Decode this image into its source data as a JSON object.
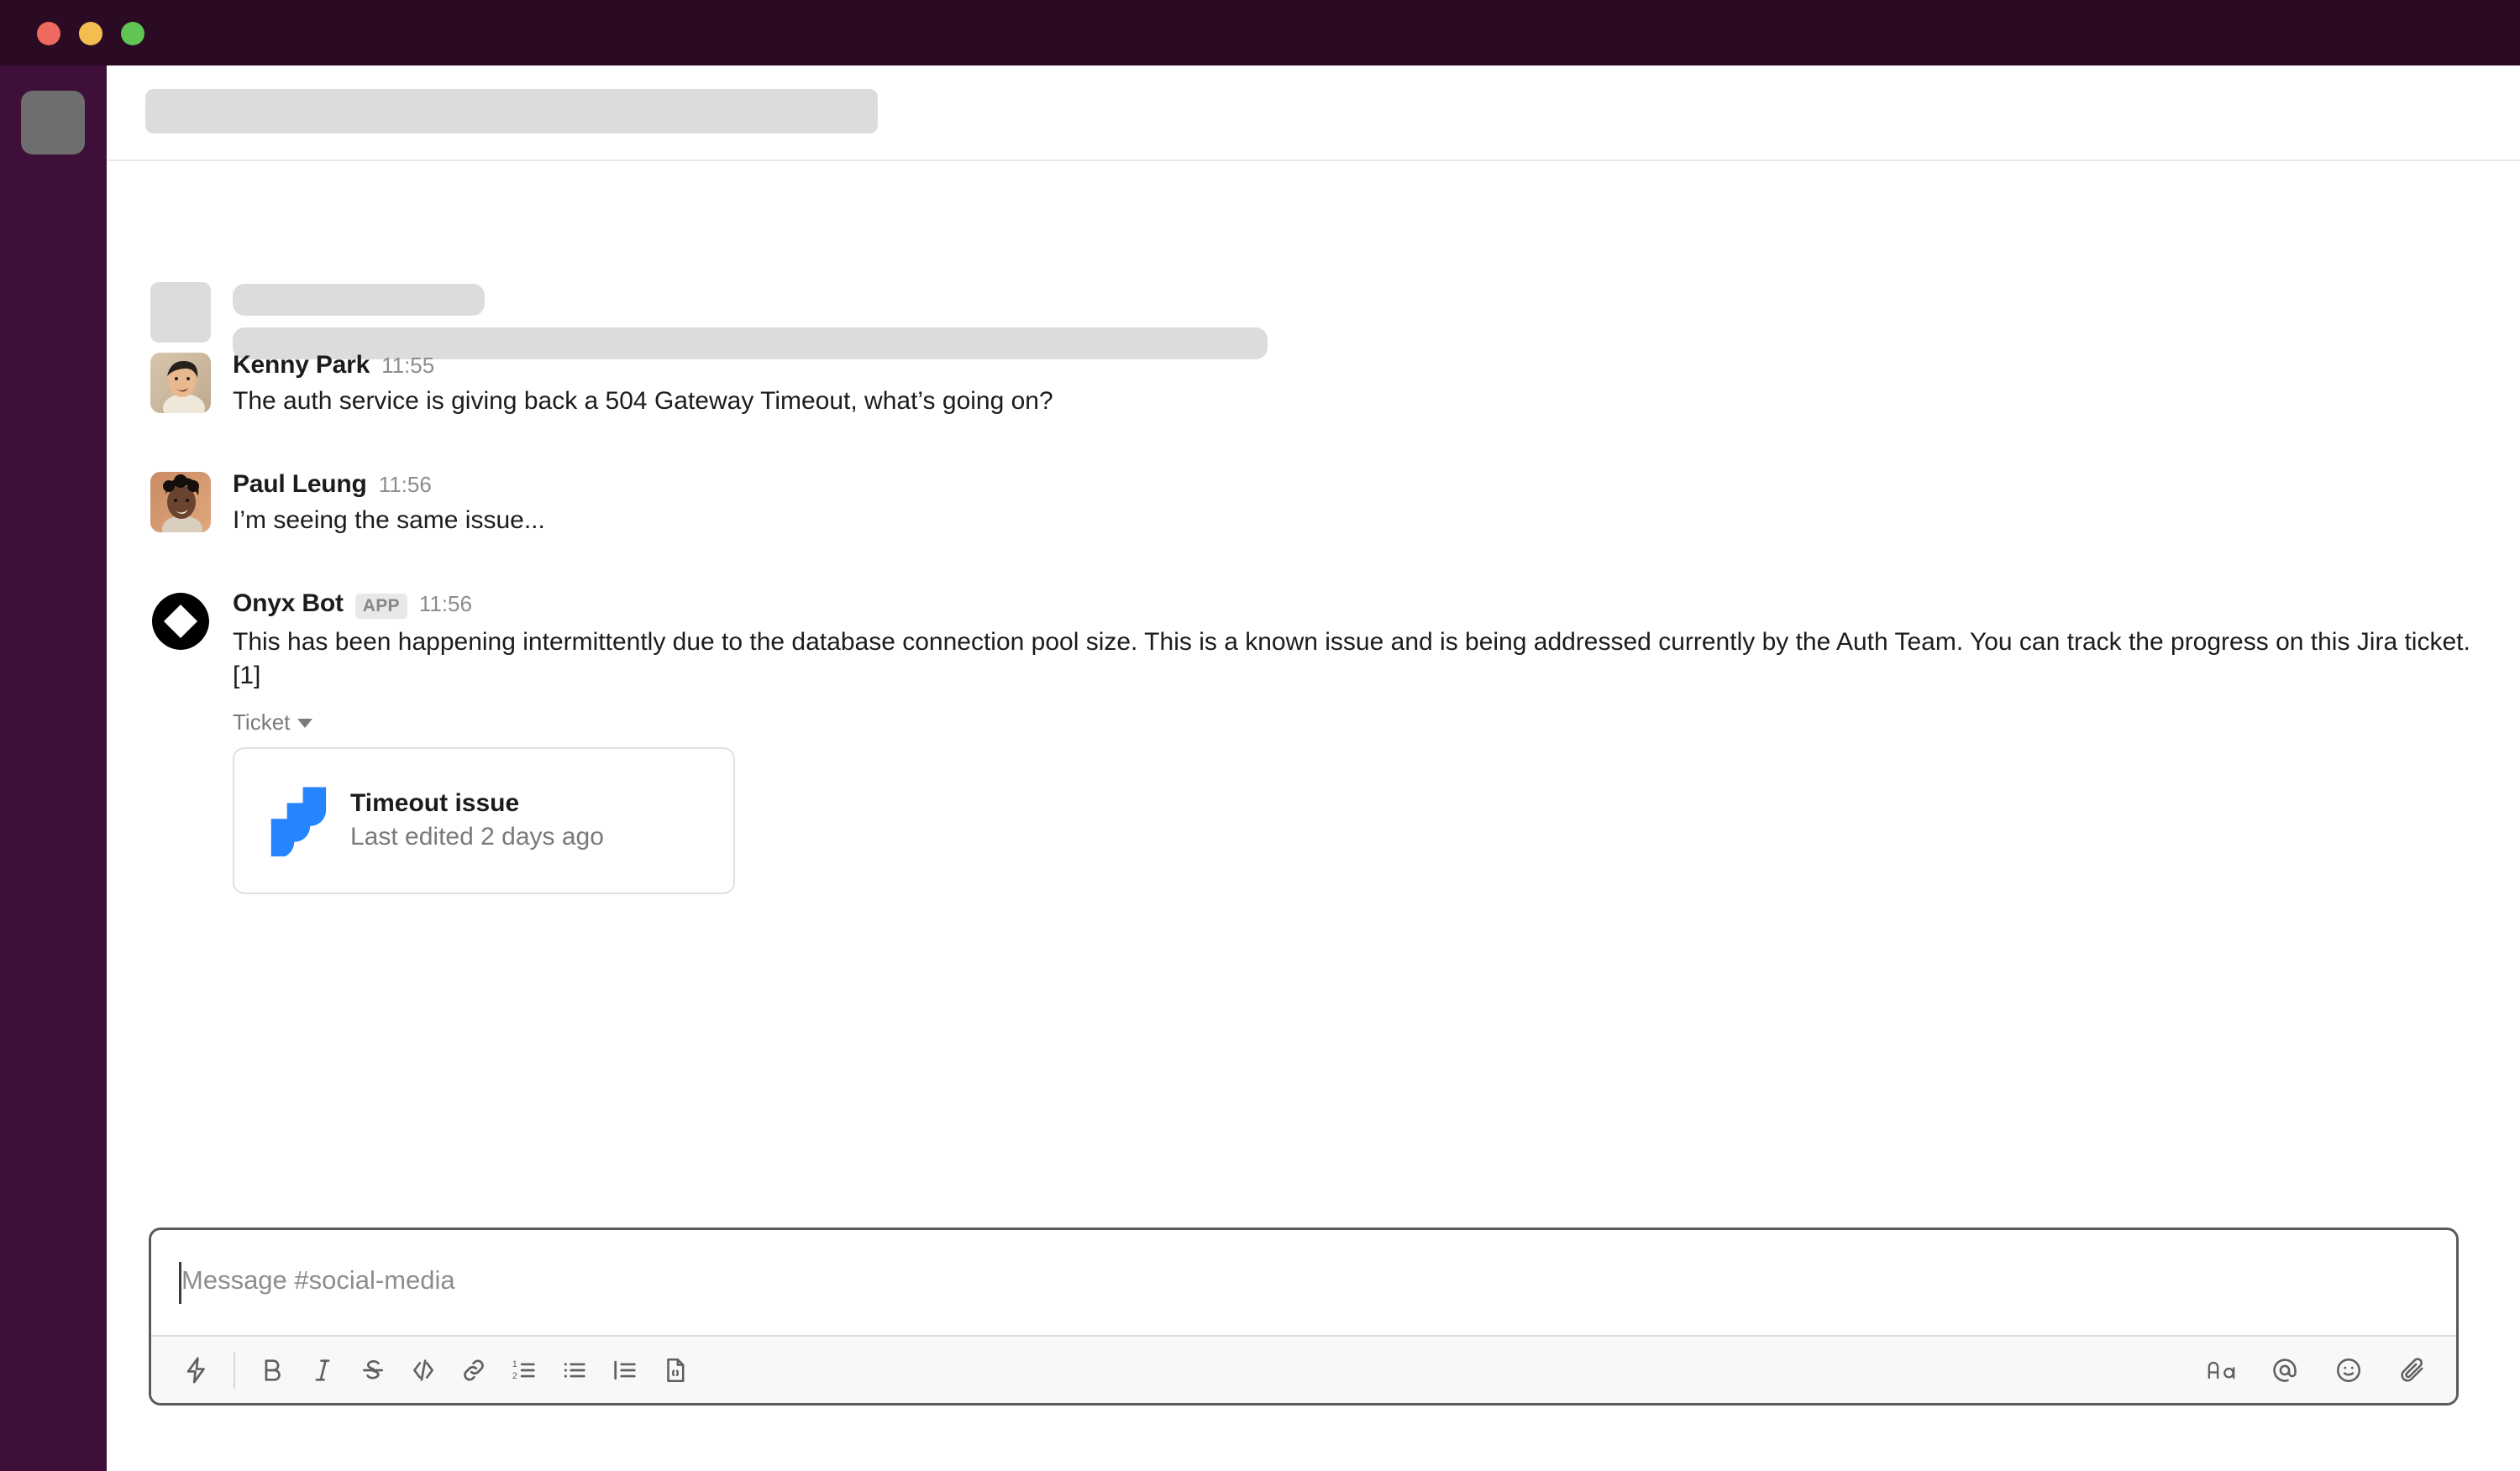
{
  "window": {
    "traffic_lights": [
      "close",
      "minimize",
      "zoom"
    ],
    "titlebar_color": "#2B0B24",
    "sidebar_color": "#3E1039"
  },
  "sidebar": {
    "workspace_tile": "workspace-avatar-placeholder"
  },
  "header": {
    "channel_title_placeholder": "loading-channel-title"
  },
  "messages": [
    {
      "type": "skeleton",
      "author": "",
      "time": "",
      "text": ""
    },
    {
      "type": "user",
      "author": "Kenny Park",
      "time": "11:55",
      "text": "The auth service is giving back a 504 Gateway Timeout, what’s going on?",
      "avatar": "kenny-park-avatar"
    },
    {
      "type": "user",
      "author": "Paul Leung",
      "time": "11:56",
      "text": "I’m seeing the same issue...",
      "avatar": "paul-leung-avatar"
    },
    {
      "type": "bot",
      "author": "Onyx Bot",
      "badge": "APP",
      "time": "11:56",
      "text": "This has been happening intermittently due to the database connection pool size. This is a known issue and is being addressed currently by the Auth Team. You can track the progress on this Jira ticket. [1]",
      "avatar": "onyx-bot-logo",
      "attachment": {
        "toggle_label": "Ticket",
        "title": "Timeout issue",
        "subtitle": "Last edited 2 days ago",
        "source_icon": "jira-icon",
        "accent_color": "#2684FF"
      }
    }
  ],
  "composer": {
    "placeholder": "Message #social-media",
    "value": "",
    "toolbar_left": [
      {
        "name": "shortcuts-lightning-icon",
        "label": "Shortcuts"
      },
      {
        "name": "bold-icon",
        "label": "Bold"
      },
      {
        "name": "italic-icon",
        "label": "Italic"
      },
      {
        "name": "strikethrough-icon",
        "label": "Strikethrough"
      },
      {
        "name": "code-icon",
        "label": "Code"
      },
      {
        "name": "link-icon",
        "label": "Link"
      },
      {
        "name": "ordered-list-icon",
        "label": "Ordered list"
      },
      {
        "name": "bulleted-list-icon",
        "label": "Bulleted list"
      },
      {
        "name": "blockquote-icon",
        "label": "Blockquote"
      },
      {
        "name": "code-block-icon",
        "label": "Code block"
      }
    ],
    "toolbar_right": [
      {
        "name": "formatting-aa-icon",
        "label": "Formatting"
      },
      {
        "name": "mention-at-icon",
        "label": "Mention someone"
      },
      {
        "name": "emoji-smiley-icon",
        "label": "Emoji"
      },
      {
        "name": "attach-paperclip-icon",
        "label": "Attach"
      }
    ]
  }
}
